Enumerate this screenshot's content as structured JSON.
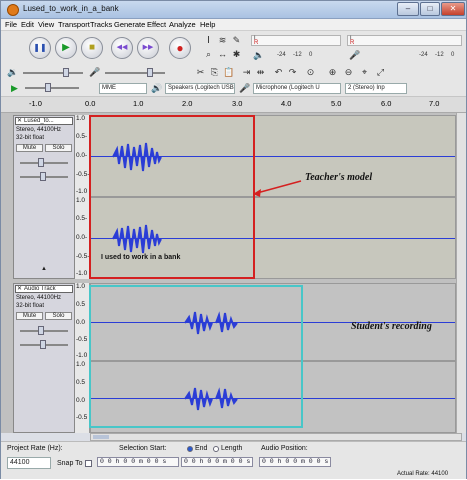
{
  "window": {
    "title": "Lused_to_work_in_a_bank",
    "min": "–",
    "max": "□",
    "close": "✕"
  },
  "menu": [
    "File",
    "Edit",
    "View",
    "Transport",
    "Tracks",
    "Generate",
    "Effect",
    "Analyze",
    "Help"
  ],
  "transport": {
    "pause": "❚❚",
    "play": "▶",
    "stop": "■",
    "skip_start": "◀◀",
    "skip_end": "▶▶",
    "record": "●"
  },
  "meters": {
    "playback_channels": [
      "L",
      "R"
    ],
    "record_channels": [
      "L",
      "R"
    ],
    "playback_scale": [
      "-24",
      "-12",
      "0"
    ],
    "record_scale": [
      "-24",
      "-12",
      "0"
    ]
  },
  "device": {
    "host": "MME",
    "output": "Speakers (Logitech USB",
    "input": "Microphone (Logitech U",
    "channels": "2 (Stereo) Inp"
  },
  "ruler": [
    "-1.0",
    "0.0",
    "1.0",
    "2.0",
    "3.0",
    "4.0",
    "5.0",
    "6.0",
    "7.0"
  ],
  "tracks": [
    {
      "name": "Lused_to...",
      "format": "Stereo, 44100Hz",
      "bits": "32-bit float",
      "mute": "Mute",
      "solo": "Solo",
      "ch1_scale": [
        "1.0",
        "0.5-",
        "0.0-",
        "-0.5-",
        "-1.0"
      ],
      "ch2_scale": [
        "1.0",
        "0.5-",
        "0.0-",
        "-0.5-",
        "-1.0"
      ]
    },
    {
      "name": "Audio Track",
      "format": "Stereo, 44100Hz",
      "bits": "32-bit float",
      "mute": "Mute",
      "solo": "Solo",
      "ch1_scale": [
        "1.0",
        "0.5",
        "0.0",
        "-0.5",
        "-1.0"
      ],
      "ch2_scale": [
        "1.0",
        "0.5",
        "0.0",
        "-0.5"
      ]
    }
  ],
  "annotations": {
    "teacher": "Teacher's model",
    "student": "Student's recording",
    "caption": "I used to work in a bank"
  },
  "bottom": {
    "project_rate_label": "Project Rate (Hz):",
    "project_rate": "44100",
    "snap_label": "Snap To",
    "selection_start_label": "Selection Start:",
    "end_label": "End",
    "length_label": "Length",
    "audio_position_label": "Audio Position:",
    "selection_start": "0 0 h 0 0 m 0 0 s",
    "selection_end": "0 0 h 0 0 m 0 0 s",
    "audio_position": "0 0 h 0 0 m 0 0 s",
    "status": "Actual Rate: 44100"
  },
  "colors": {
    "waveform": "#2b3dd6",
    "teacher_box": "#d42020",
    "student_box": "#48c6c8"
  }
}
